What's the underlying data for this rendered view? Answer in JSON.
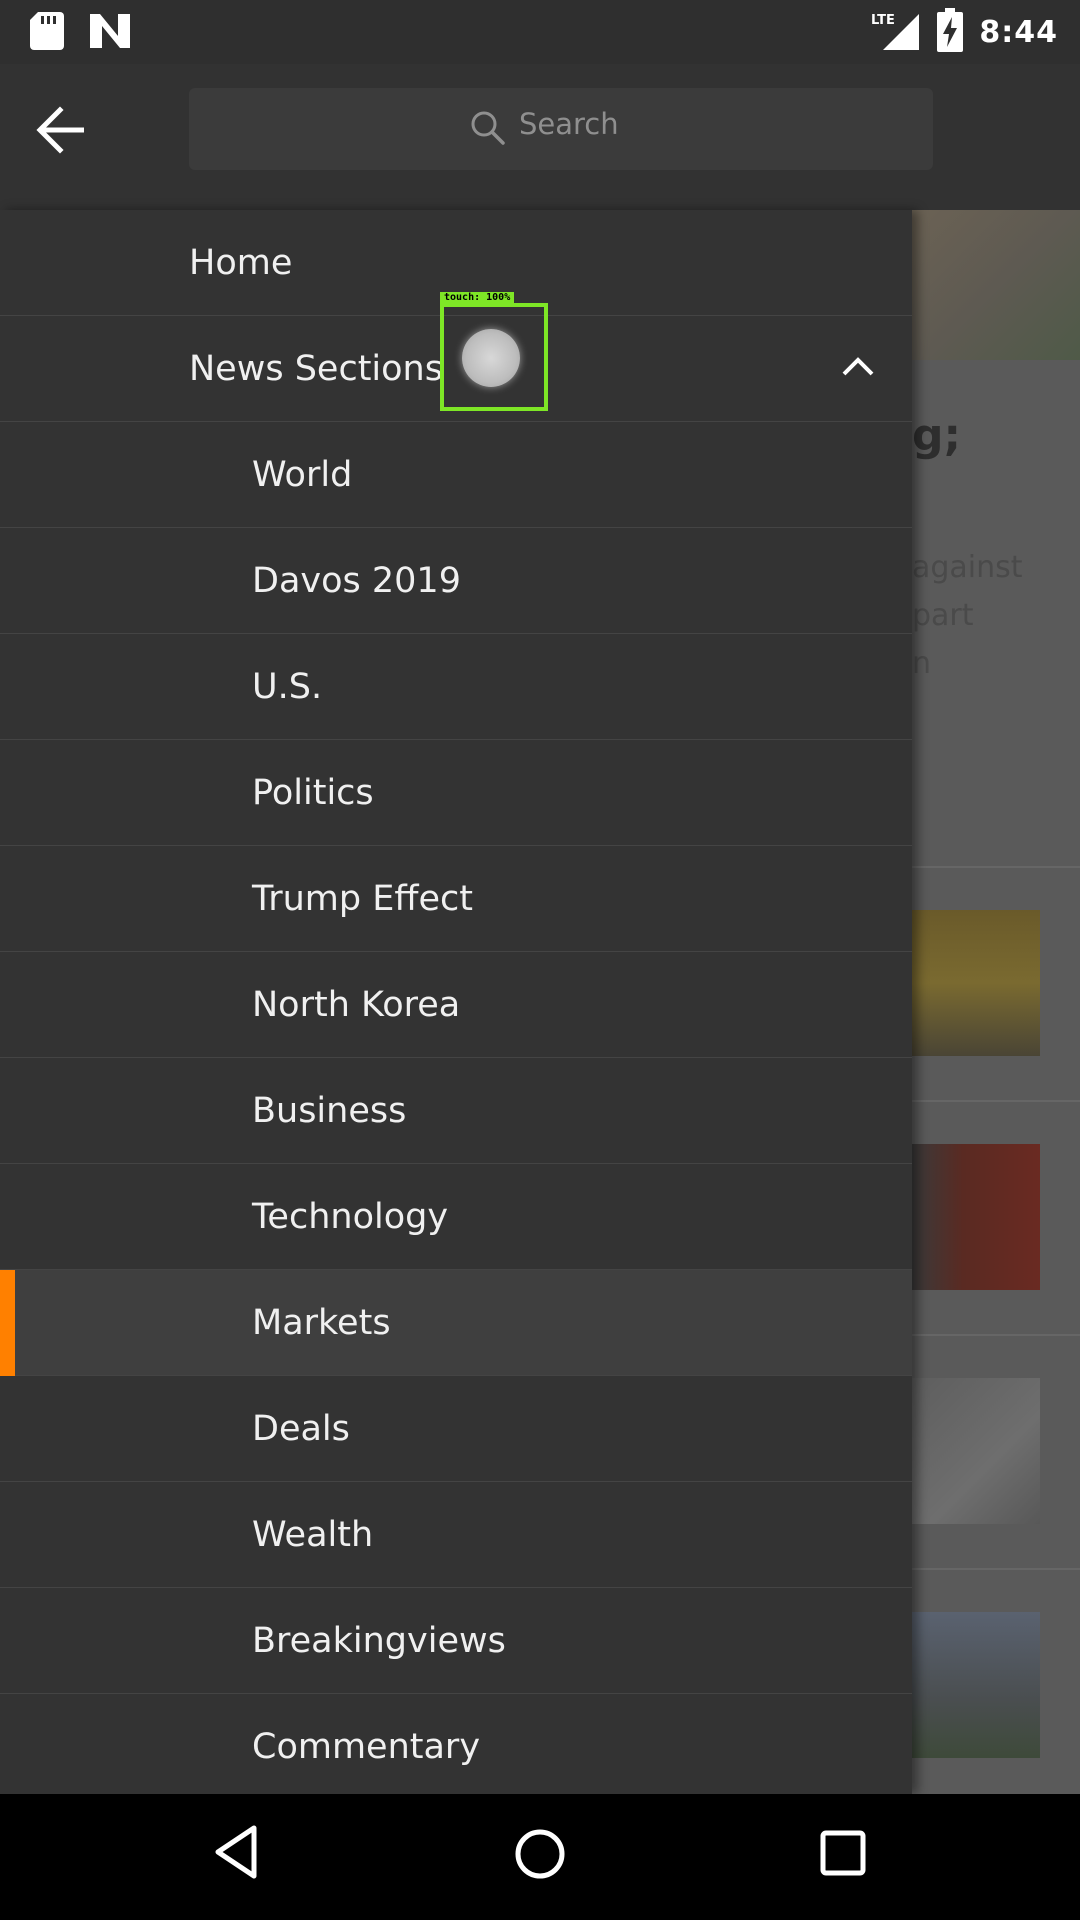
{
  "status_bar": {
    "time": "8:44",
    "network": "LTE",
    "icons": [
      "sd-card-icon",
      "n-logo-icon",
      "lte-signal-icon",
      "battery-charging-icon"
    ]
  },
  "app_bar": {
    "search_placeholder": "Search",
    "back_icon": "arrow-left-icon",
    "search_icon": "search-icon"
  },
  "touch_indicator": {
    "label": "touch: 100%"
  },
  "drawer": {
    "items": [
      {
        "label": "Home",
        "level": "top"
      },
      {
        "label": "News Sections",
        "level": "top",
        "expanded": true
      },
      {
        "label": "World",
        "level": "sub"
      },
      {
        "label": "Davos 2019",
        "level": "sub"
      },
      {
        "label": "U.S.",
        "level": "sub"
      },
      {
        "label": "Politics",
        "level": "sub"
      },
      {
        "label": "Trump Effect",
        "level": "sub"
      },
      {
        "label": "North Korea",
        "level": "sub"
      },
      {
        "label": "Business",
        "level": "sub"
      },
      {
        "label": "Technology",
        "level": "sub"
      },
      {
        "label": "Markets",
        "level": "sub",
        "selected": true
      },
      {
        "label": "Deals",
        "level": "sub"
      },
      {
        "label": "Wealth",
        "level": "sub"
      },
      {
        "label": "Breakingviews",
        "level": "sub"
      },
      {
        "label": "Commentary",
        "level": "sub"
      }
    ],
    "accent_color": "#ff8000"
  },
  "background_article": {
    "headline_fragment": "g;",
    "body_fragments": [
      "against",
      "part",
      "n"
    ]
  },
  "nav_bar": {
    "icons": [
      "back-triangle-icon",
      "home-circle-icon",
      "recents-square-icon"
    ]
  }
}
